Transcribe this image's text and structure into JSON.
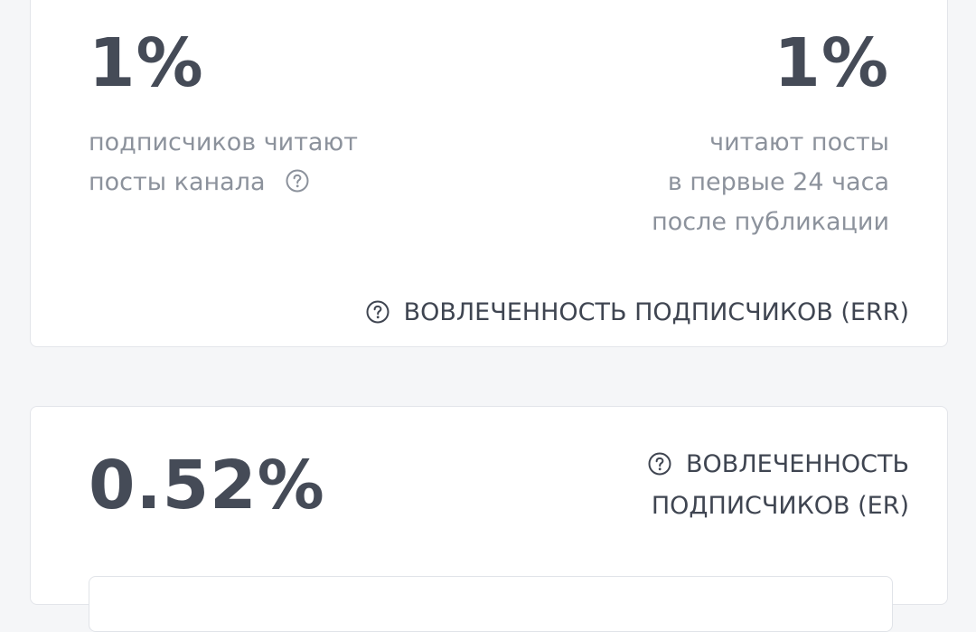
{
  "err_card": {
    "left_value": "1%",
    "left_desc_line1": "подписчиков читают",
    "left_desc_line2": "посты канала",
    "right_value": "1%",
    "right_desc_line1": "читают посты",
    "right_desc_line2": "в первые 24 часа",
    "right_desc_line3": "после публикации",
    "caption": "ВОВЛЕЧЕННОСТЬ ПОДПИСЧИКОВ (ERR)"
  },
  "er_card": {
    "value": "0.52%",
    "caption_line1": "ВОВЛЕЧЕННОСТЬ",
    "caption_line2": "ПОДПИСЧИКОВ (ER)"
  },
  "icons": {
    "help": "question-circle-icon"
  },
  "colors": {
    "page_bg": "#f5f6f8",
    "value_text": "#454b57",
    "desc_text": "#8c929c",
    "caption_text": "#3f4551"
  }
}
